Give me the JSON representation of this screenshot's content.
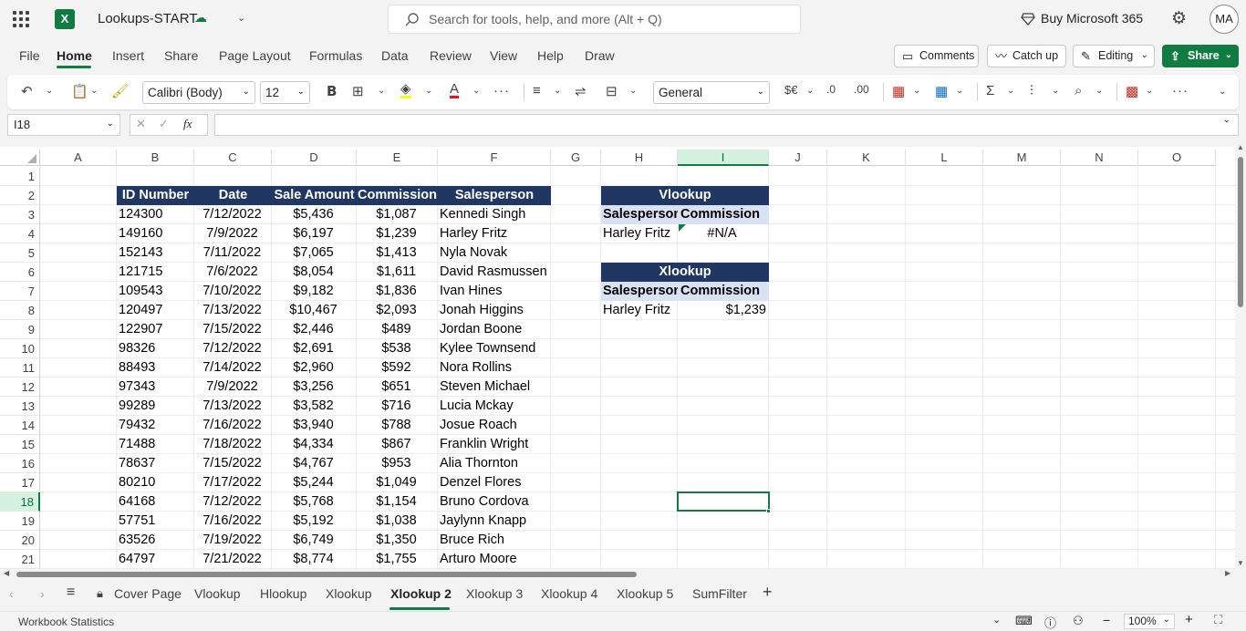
{
  "app": {
    "title": "Lookups-START",
    "search_placeholder": "Search for tools, help, and more (Alt + Q)",
    "buy_label": "Buy Microsoft 365",
    "avatar_initials": "MA",
    "accent_color": "#107c41"
  },
  "menu": {
    "items": [
      "File",
      "Home",
      "Insert",
      "Share",
      "Page Layout",
      "Formulas",
      "Data",
      "Review",
      "View",
      "Help",
      "Draw"
    ],
    "active": "Home",
    "comments_label": "Comments",
    "catchup_label": "Catch up",
    "editing_label": "Editing",
    "share_label": "Share"
  },
  "ribbon": {
    "font_name": "Calibri (Body)",
    "font_size": "12",
    "number_format": "General",
    "currency_label": "$€"
  },
  "formula_bar": {
    "name_box": "I18",
    "fx_label": "fx",
    "formula": ""
  },
  "grid": {
    "columns": [
      "A",
      "B",
      "C",
      "D",
      "E",
      "F",
      "G",
      "H",
      "I",
      "J",
      "K",
      "L",
      "M",
      "N",
      "O"
    ],
    "selected_column": "I",
    "rows": [
      "1",
      "2",
      "3",
      "4",
      "5",
      "6",
      "7",
      "8",
      "9",
      "10",
      "11",
      "12",
      "13",
      "14",
      "15",
      "16",
      "17",
      "18",
      "19",
      "20",
      "21"
    ],
    "selected_row": "18"
  },
  "sales_table": {
    "headers": [
      "ID Number",
      "Date",
      "Sale Amount",
      "Commission",
      "Salesperson"
    ],
    "rows": [
      [
        "124300",
        "7/12/2022",
        "$5,436",
        "$1,087",
        "Kennedi Singh"
      ],
      [
        "149160",
        "7/9/2022",
        "$6,197",
        "$1,239",
        "Harley Fritz"
      ],
      [
        "152143",
        "7/11/2022",
        "$7,065",
        "$1,413",
        "Nyla Novak"
      ],
      [
        "121715",
        "7/6/2022",
        "$8,054",
        "$1,611",
        "David Rasmussen"
      ],
      [
        "109543",
        "7/10/2022",
        "$9,182",
        "$1,836",
        "Ivan Hines"
      ],
      [
        "120497",
        "7/13/2022",
        "$10,467",
        "$2,093",
        "Jonah Higgins"
      ],
      [
        "122907",
        "7/15/2022",
        "$2,446",
        "$489",
        "Jordan Boone"
      ],
      [
        "98326",
        "7/12/2022",
        "$2,691",
        "$538",
        "Kylee Townsend"
      ],
      [
        "88493",
        "7/14/2022",
        "$2,960",
        "$592",
        "Nora Rollins"
      ],
      [
        "97343",
        "7/9/2022",
        "$3,256",
        "$651",
        "Steven Michael"
      ],
      [
        "99289",
        "7/13/2022",
        "$3,582",
        "$716",
        "Lucia Mckay"
      ],
      [
        "79432",
        "7/16/2022",
        "$3,940",
        "$788",
        "Josue Roach"
      ],
      [
        "71488",
        "7/18/2022",
        "$4,334",
        "$867",
        "Franklin Wright"
      ],
      [
        "78637",
        "7/15/2022",
        "$4,767",
        "$953",
        "Alia Thornton"
      ],
      [
        "80210",
        "7/17/2022",
        "$5,244",
        "$1,049",
        "Denzel Flores"
      ],
      [
        "64168",
        "7/12/2022",
        "$5,768",
        "$1,154",
        "Bruno Cordova"
      ],
      [
        "57751",
        "7/16/2022",
        "$5,192",
        "$1,038",
        "Jaylynn Knapp"
      ],
      [
        "63526",
        "7/19/2022",
        "$6,749",
        "$1,350",
        "Bruce Rich"
      ],
      [
        "64797",
        "7/21/2022",
        "$8,774",
        "$1,755",
        "Arturo Moore"
      ]
    ]
  },
  "vlookup_box": {
    "title": "Vlookup",
    "col1": "Salesperson",
    "col2": "Commission",
    "name": "Harley Fritz",
    "result": "#N/A"
  },
  "xlookup_box": {
    "title": "Xlookup",
    "col1": "Salesperson",
    "col2": "Commission",
    "name": "Harley Fritz",
    "result": "$1,239"
  },
  "sheet_tabs": {
    "tabs": [
      "Cover Page",
      "Vlookup",
      "Hlookup",
      "Xlookup",
      "Xlookup 2",
      "Xlookup 3",
      "Xlookup 4",
      "Xlookup 5",
      "SumFilter"
    ],
    "active": "Xlookup 2"
  },
  "status_bar": {
    "left_text": "Workbook Statistics",
    "zoom": "100%"
  }
}
